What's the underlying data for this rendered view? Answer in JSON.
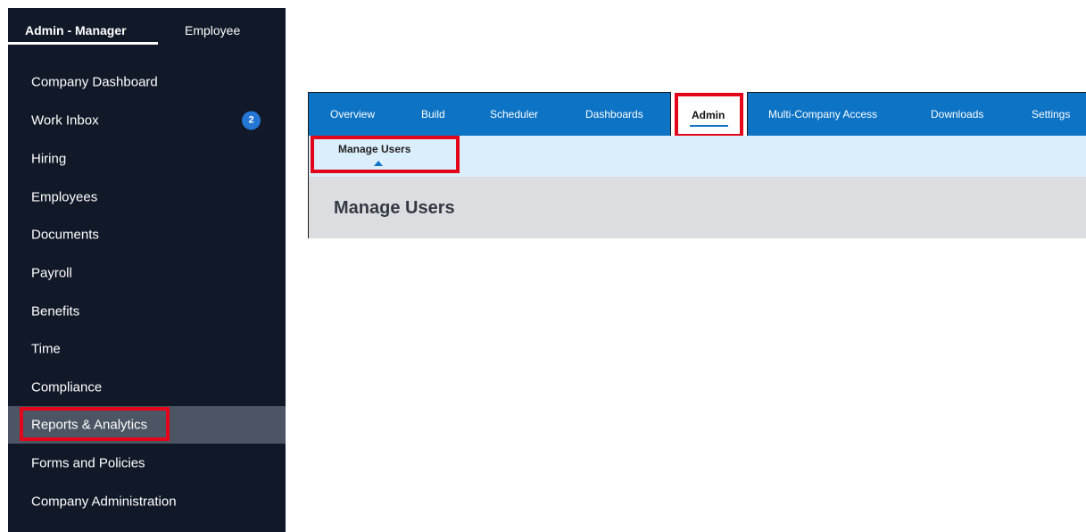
{
  "sidebar": {
    "role_tabs": {
      "admin_label": "Admin - Manager",
      "employee_label": "Employee"
    },
    "items": [
      {
        "label": "Company Dashboard"
      },
      {
        "label": "Work Inbox",
        "badge": "2"
      },
      {
        "label": "Hiring"
      },
      {
        "label": "Employees"
      },
      {
        "label": "Documents"
      },
      {
        "label": "Payroll"
      },
      {
        "label": "Benefits"
      },
      {
        "label": "Time"
      },
      {
        "label": "Compliance"
      },
      {
        "label": "Reports & Analytics",
        "active": true
      },
      {
        "label": "Forms and Policies"
      },
      {
        "label": "Company Administration"
      }
    ]
  },
  "topnav": {
    "tabs": [
      "Overview",
      "Build",
      "Scheduler",
      "Dashboards",
      "Admin",
      "Multi-Company Access",
      "Downloads",
      "Settings"
    ]
  },
  "subnav": {
    "label": "Manage Users"
  },
  "content": {
    "title": "Manage Users"
  },
  "colors": {
    "sidebar_bg": "#111828",
    "sidebar_active_bg": "#4b5564",
    "badge_bg": "#2476d4",
    "topnav_bg": "#0c73c5",
    "subnav_bg": "#dbeefc",
    "content_bg": "#dcdde0",
    "highlight_red": "#e3061b"
  }
}
